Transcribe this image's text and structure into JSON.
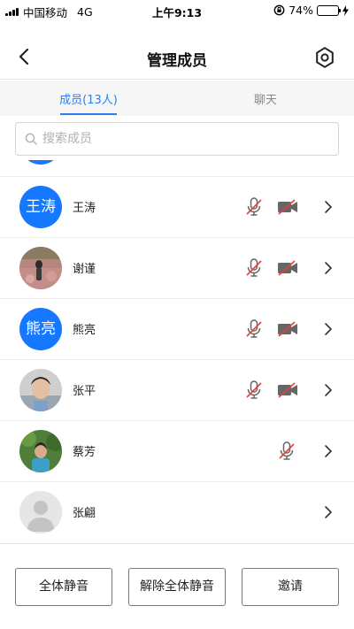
{
  "status_bar": {
    "carrier": "中国移动",
    "network": "4G",
    "time": "上午9:13",
    "battery": "74%",
    "battery_level": 0.74
  },
  "header": {
    "title": "管理成员",
    "back_icon": "chevron-left-icon",
    "settings_icon": "gear-icon"
  },
  "tabs": [
    {
      "label": "成员(13人)",
      "active": true
    },
    {
      "label": "聊天",
      "active": false
    }
  ],
  "search": {
    "placeholder": "搜索成员",
    "value": ""
  },
  "members": [
    {
      "name": "王涛",
      "avatar_text": "王涛",
      "avatar_type": "text",
      "mic_muted": true,
      "camera_off": true
    },
    {
      "name": "谢谨",
      "avatar_text": "",
      "avatar_type": "photo",
      "mic_muted": true,
      "camera_off": true
    },
    {
      "name": "熊亮",
      "avatar_text": "熊亮",
      "avatar_type": "text",
      "mic_muted": true,
      "camera_off": true
    },
    {
      "name": "张平",
      "avatar_text": "",
      "avatar_type": "photo",
      "mic_muted": true,
      "camera_off": true
    },
    {
      "name": "蔡芳",
      "avatar_text": "",
      "avatar_type": "photo",
      "mic_muted": true,
      "camera_off": null
    },
    {
      "name": "张翩",
      "avatar_text": "",
      "avatar_type": "default",
      "mic_muted": null,
      "camera_off": null
    }
  ],
  "actions": {
    "mute_all": "全体静音",
    "unmute_all": "解除全体静音",
    "invite": "邀请"
  },
  "colors": {
    "accent": "#2a7ef0",
    "avatar_blue": "#1677ff",
    "muted_red": "#e0423a"
  }
}
